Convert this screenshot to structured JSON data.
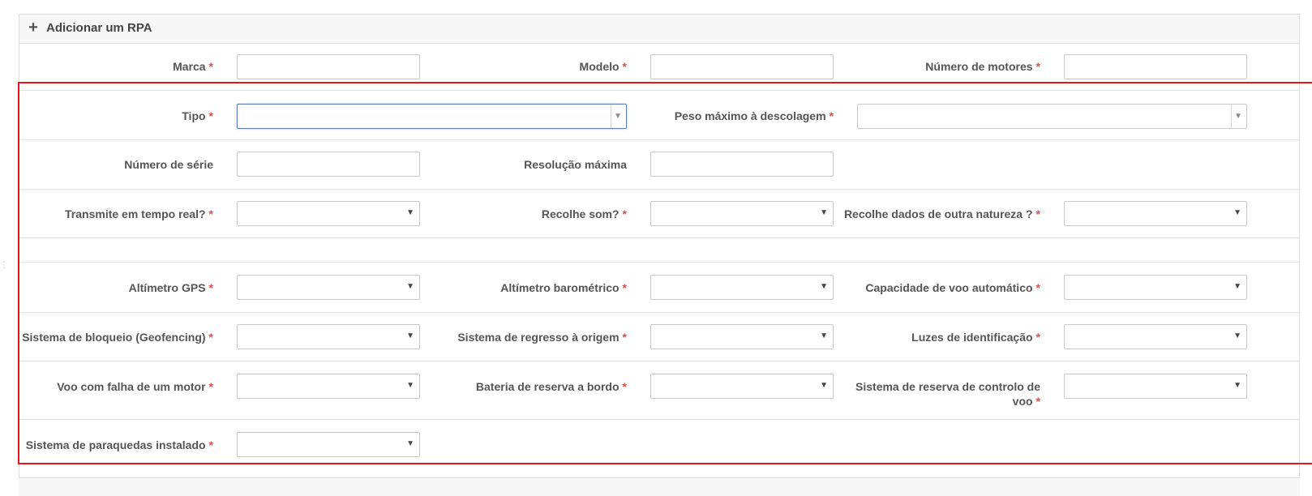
{
  "panel": {
    "title": "Adicionar um RPA",
    "icon": "plus-icon"
  },
  "required_mark": "*",
  "colors": {
    "required": "#d9534f",
    "highlight": "#e8131b",
    "focus_border": "#5b7db6"
  },
  "fields": {
    "marca": {
      "label": "Marca",
      "value": ""
    },
    "modelo": {
      "label": "Modelo",
      "value": ""
    },
    "numero_motores": {
      "label": "Número de motores",
      "value": ""
    },
    "tipo": {
      "label": "Tipo",
      "value": ""
    },
    "peso_maximo": {
      "label": "Peso máximo à descolagem",
      "value": ""
    },
    "numero_serie": {
      "label": "Número de série",
      "value": ""
    },
    "resolucao_maxima": {
      "label": "Resolução máxima",
      "value": ""
    },
    "transmite_tempo_real": {
      "label": "Transmite em tempo real?",
      "value": ""
    },
    "recolhe_som": {
      "label": "Recolhe som?",
      "value": ""
    },
    "recolhe_dados": {
      "label": "Recolhe dados de outra natureza ?",
      "value": ""
    },
    "altimetro_gps": {
      "label": "Altímetro GPS",
      "value": ""
    },
    "altimetro_barometrico": {
      "label": "Altímetro barométrico",
      "value": ""
    },
    "capacidade_voo_auto": {
      "label": "Capacidade de voo automático",
      "value": ""
    },
    "sistema_bloqueio": {
      "label": "Sistema de bloqueio (Geofencing)",
      "value": ""
    },
    "sistema_regresso": {
      "label": "Sistema de regresso à origem",
      "value": ""
    },
    "luzes_identificacao": {
      "label": "Luzes de identificação",
      "value": ""
    },
    "voo_falha_motor": {
      "label": "Voo com falha de um motor",
      "value": ""
    },
    "bateria_reserva": {
      "label": "Bateria de reserva a bordo",
      "value": ""
    },
    "sistema_reserva_controlo": {
      "label_line1": "Sistema de reserva de controlo de",
      "label_line2": "voo",
      "value": ""
    },
    "sistema_paraquedas": {
      "label": "Sistema de paraquedas instalado",
      "value": ""
    }
  },
  "arrow_glyph": "▼"
}
